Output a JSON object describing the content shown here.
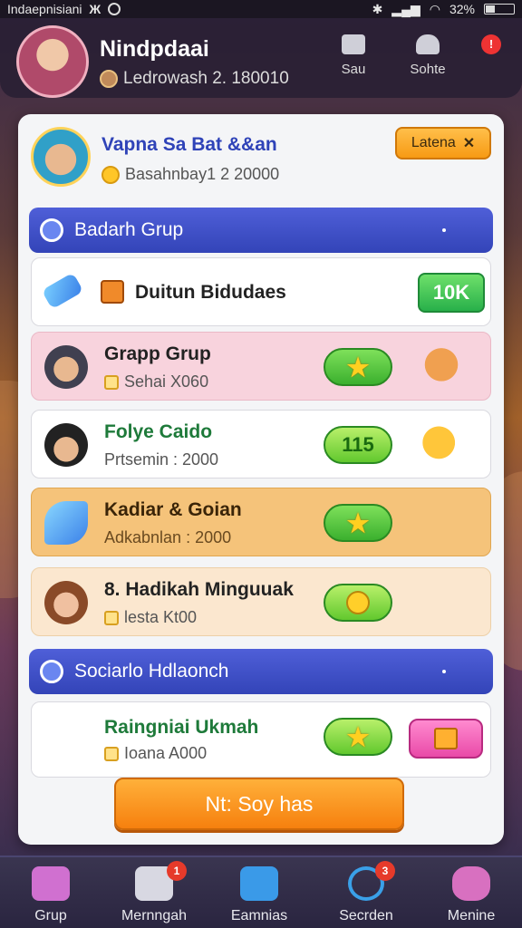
{
  "status_bar": {
    "carrier": "Indaepnisiani",
    "app_glyph": "Ж",
    "battery": "32%",
    "battery_level": 0.32
  },
  "header": {
    "name": "Nindpdaai",
    "subtitle": "Ledrowash 2. 180010",
    "buttons": [
      {
        "label": "Sau",
        "icon": "chat-icon"
      },
      {
        "label": "Sohte",
        "icon": "profile-icon"
      }
    ],
    "notification_badge": "!"
  },
  "profile": {
    "title": "Vapna Sa Bat &&an",
    "subtitle": "Basahnbay1 2 20000",
    "action_label": "Latena"
  },
  "sections": [
    {
      "title": "Badarh Grup"
    },
    {
      "title": "Sociarlo Hdlaonch"
    }
  ],
  "rows": [
    {
      "title": "Duitun Bidudaes",
      "action": "10K",
      "action_type": "green-button"
    },
    {
      "title": "Grapp Grup",
      "subtitle": "Sehai X060",
      "action_type": "star-pill"
    },
    {
      "title": "Folye Caido",
      "subtitle": "Prtsemin : 2000",
      "action": "115",
      "action_type": "number-pill"
    },
    {
      "title": "Kadiar & Goian",
      "subtitle": "Adkabnlan : 2000",
      "action_type": "star-pill"
    },
    {
      "title": "8. Hadikah Minguuak",
      "subtitle": "lesta Kt00",
      "action_type": "medal-pill"
    },
    {
      "title": "Raingniai Ukmah",
      "subtitle": "Ioana A000",
      "action_type": "star-pill"
    }
  ],
  "cta_label": "Nt: Soy has",
  "bottom_nav": [
    {
      "label": "Grup",
      "badge": ""
    },
    {
      "label": "Mernngah",
      "badge": "1"
    },
    {
      "label": "Eamnias",
      "badge": ""
    },
    {
      "label": "Secrden",
      "badge": "3"
    },
    {
      "label": "Menine",
      "badge": ""
    }
  ],
  "colors": {
    "accent_blue": "#3344b8",
    "accent_orange": "#f79a14",
    "accent_green": "#3bb02e",
    "row_pink": "#f8d3dd",
    "row_orange": "#f5c37a",
    "row_cream": "#fbe7cf"
  }
}
